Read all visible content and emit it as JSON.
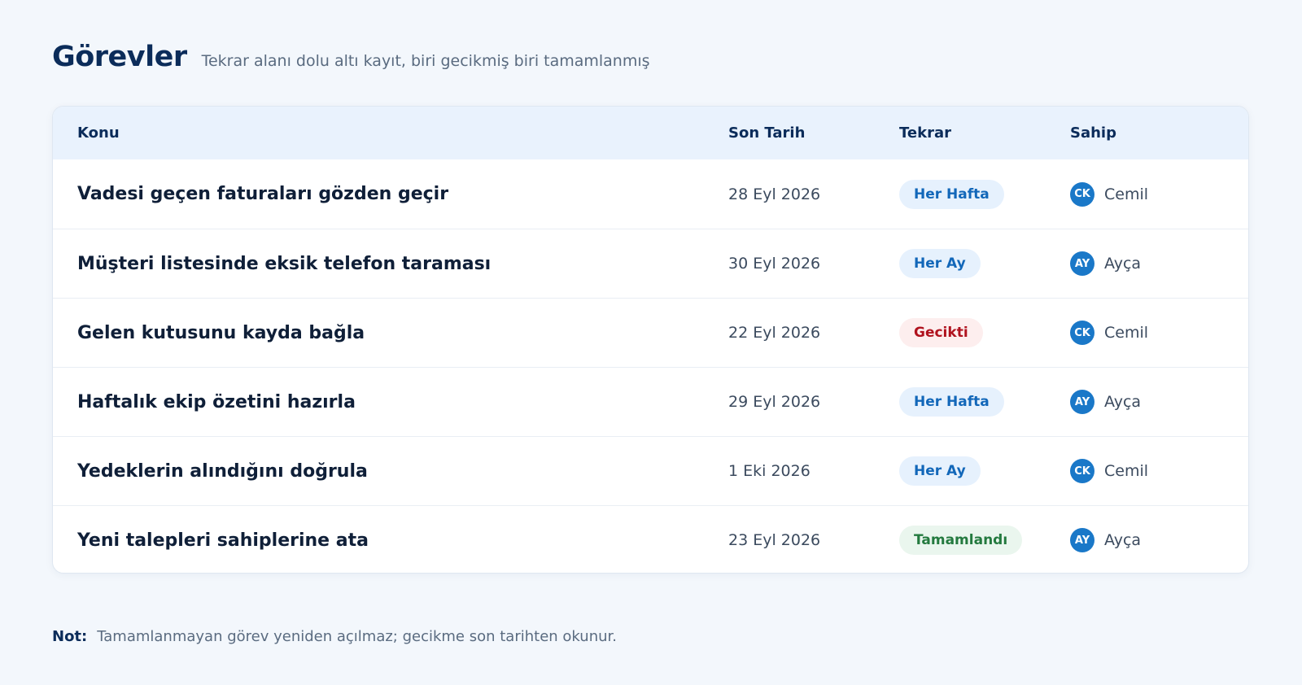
{
  "header": {
    "title": "Görevler",
    "subtitle": "Tekrar alanı dolu altı kayıt, biri gecikmiş biri tamamlanmış"
  },
  "table": {
    "columns": [
      "Konu",
      "Son Tarih",
      "Tekrar",
      "Sahip"
    ],
    "rows": [
      {
        "subject": "Vadesi geçen faturaları gözden geçir",
        "date": "28 Eyl 2026",
        "repeat": "Her Hafta",
        "repeat_status": "blue",
        "owner_initials": "CK",
        "owner": "Cemil"
      },
      {
        "subject": "Müşteri listesinde eksik telefon taraması",
        "date": "30 Eyl 2026",
        "repeat": "Her Ay",
        "repeat_status": "blue",
        "owner_initials": "AY",
        "owner": "Ayça"
      },
      {
        "subject": "Gelen kutusunu kayda bağla",
        "date": "22 Eyl 2026",
        "repeat": "Gecikti",
        "repeat_status": "red",
        "owner_initials": "CK",
        "owner": "Cemil"
      },
      {
        "subject": "Haftalık ekip özetini hazırla",
        "date": "29 Eyl 2026",
        "repeat": "Her Hafta",
        "repeat_status": "blue",
        "owner_initials": "AY",
        "owner": "Ayça"
      },
      {
        "subject": "Yedeklerin alındığını doğrula",
        "date": "1 Eki 2026",
        "repeat": "Her Ay",
        "repeat_status": "blue",
        "owner_initials": "CK",
        "owner": "Cemil"
      },
      {
        "subject": "Yeni talepleri sahiplerine ata",
        "date": "23 Eyl 2026",
        "repeat": "Tamamlandı",
        "repeat_status": "green",
        "owner_initials": "AY",
        "owner": "Ayça"
      }
    ]
  },
  "note": {
    "label": "Not:",
    "text": "Tamamlanmayan görev yeniden açılmaz; gecikme son tarihten okunur."
  },
  "colors": {
    "accent": "#1a78c8",
    "badge_blue": "#1267b9",
    "badge_red": "#b0121e",
    "badge_green": "#247a3f"
  }
}
